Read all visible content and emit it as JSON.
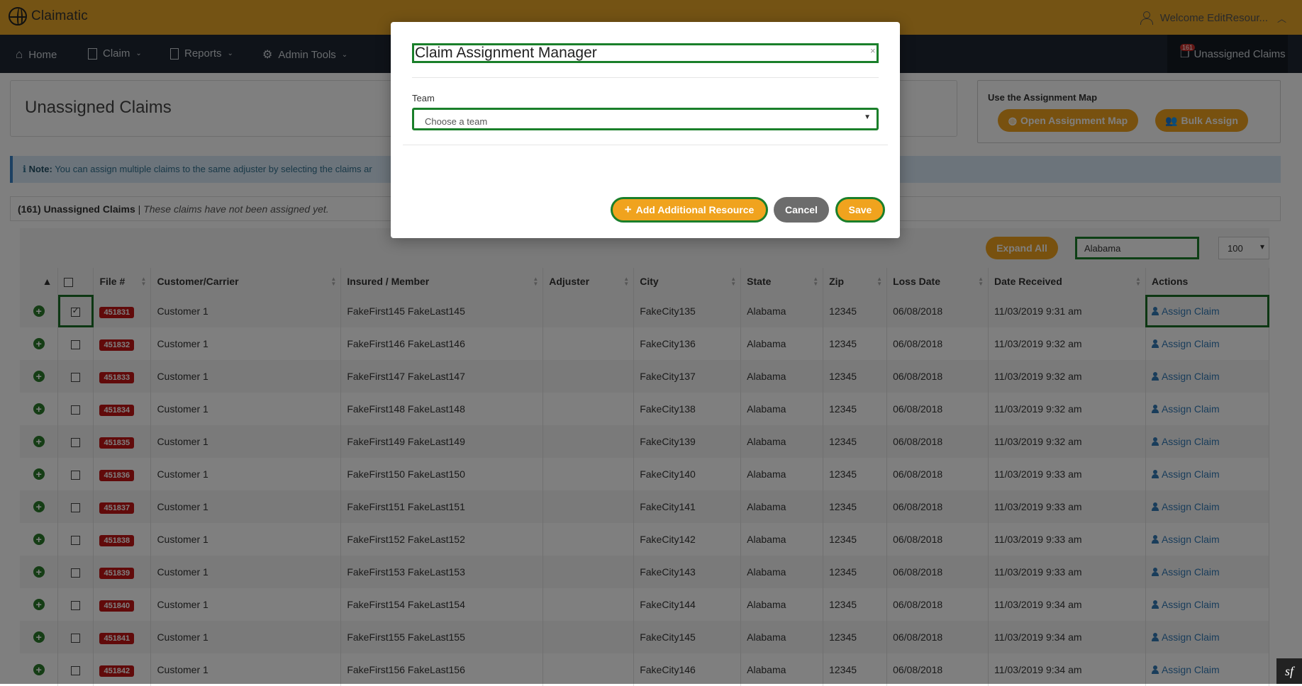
{
  "app": {
    "name": "Claimatic",
    "welcome": "Welcome EditResour..."
  },
  "nav": {
    "home": "Home",
    "claim": "Claim",
    "reports": "Reports",
    "admin_tools": "Admin Tools",
    "unassigned_claims": "Unassigned Claims",
    "unassigned_count": "161"
  },
  "page": {
    "title": "Unassigned Claims",
    "assign_map_title": "Use the Assignment Map",
    "open_map_label": "Open Assignment Map",
    "bulk_assign_label": "Bulk Assign",
    "note_label": "Note:",
    "note_text": "You can assign multiple claims to the same adjuster by selecting the claims ar",
    "list_count": "(161) Unassigned Claims",
    "list_sub": "These claims have not been assigned yet."
  },
  "tools": {
    "expand_all": "Expand All",
    "search_value": "Alabama",
    "page_size": "100"
  },
  "table": {
    "headers": [
      "File #",
      "Customer/Carrier",
      "Insured / Member",
      "Adjuster",
      "City",
      "State",
      "Zip",
      "Loss Date",
      "Date Received",
      "Actions"
    ],
    "action_label": "Assign Claim",
    "rows": [
      {
        "file": "451831",
        "customer": "Customer 1",
        "insured": "FakeFirst145 FakeLast145",
        "adjuster": "",
        "city": "FakeCity135",
        "state": "Alabama",
        "zip": "12345",
        "loss": "06/08/2018",
        "received": "11/03/2019 9:31 am",
        "checked": true
      },
      {
        "file": "451832",
        "customer": "Customer 1",
        "insured": "FakeFirst146 FakeLast146",
        "adjuster": "",
        "city": "FakeCity136",
        "state": "Alabama",
        "zip": "12345",
        "loss": "06/08/2018",
        "received": "11/03/2019 9:32 am",
        "checked": false
      },
      {
        "file": "451833",
        "customer": "Customer 1",
        "insured": "FakeFirst147 FakeLast147",
        "adjuster": "",
        "city": "FakeCity137",
        "state": "Alabama",
        "zip": "12345",
        "loss": "06/08/2018",
        "received": "11/03/2019 9:32 am",
        "checked": false
      },
      {
        "file": "451834",
        "customer": "Customer 1",
        "insured": "FakeFirst148 FakeLast148",
        "adjuster": "",
        "city": "FakeCity138",
        "state": "Alabama",
        "zip": "12345",
        "loss": "06/08/2018",
        "received": "11/03/2019 9:32 am",
        "checked": false
      },
      {
        "file": "451835",
        "customer": "Customer 1",
        "insured": "FakeFirst149 FakeLast149",
        "adjuster": "",
        "city": "FakeCity139",
        "state": "Alabama",
        "zip": "12345",
        "loss": "06/08/2018",
        "received": "11/03/2019 9:32 am",
        "checked": false
      },
      {
        "file": "451836",
        "customer": "Customer 1",
        "insured": "FakeFirst150 FakeLast150",
        "adjuster": "",
        "city": "FakeCity140",
        "state": "Alabama",
        "zip": "12345",
        "loss": "06/08/2018",
        "received": "11/03/2019 9:33 am",
        "checked": false
      },
      {
        "file": "451837",
        "customer": "Customer 1",
        "insured": "FakeFirst151 FakeLast151",
        "adjuster": "",
        "city": "FakeCity141",
        "state": "Alabama",
        "zip": "12345",
        "loss": "06/08/2018",
        "received": "11/03/2019 9:33 am",
        "checked": false
      },
      {
        "file": "451838",
        "customer": "Customer 1",
        "insured": "FakeFirst152 FakeLast152",
        "adjuster": "",
        "city": "FakeCity142",
        "state": "Alabama",
        "zip": "12345",
        "loss": "06/08/2018",
        "received": "11/03/2019 9:33 am",
        "checked": false
      },
      {
        "file": "451839",
        "customer": "Customer 1",
        "insured": "FakeFirst153 FakeLast153",
        "adjuster": "",
        "city": "FakeCity143",
        "state": "Alabama",
        "zip": "12345",
        "loss": "06/08/2018",
        "received": "11/03/2019 9:33 am",
        "checked": false
      },
      {
        "file": "451840",
        "customer": "Customer 1",
        "insured": "FakeFirst154 FakeLast154",
        "adjuster": "",
        "city": "FakeCity144",
        "state": "Alabama",
        "zip": "12345",
        "loss": "06/08/2018",
        "received": "11/03/2019 9:34 am",
        "checked": false
      },
      {
        "file": "451841",
        "customer": "Customer 1",
        "insured": "FakeFirst155 FakeLast155",
        "adjuster": "",
        "city": "FakeCity145",
        "state": "Alabama",
        "zip": "12345",
        "loss": "06/08/2018",
        "received": "11/03/2019 9:34 am",
        "checked": false
      },
      {
        "file": "451842",
        "customer": "Customer 1",
        "insured": "FakeFirst156 FakeLast156",
        "adjuster": "",
        "city": "FakeCity146",
        "state": "Alabama",
        "zip": "12345",
        "loss": "06/08/2018",
        "received": "11/03/2019 9:34 am",
        "checked": false
      }
    ]
  },
  "modal": {
    "title": "Claim Assignment Manager",
    "close": "×",
    "team_label": "Team",
    "team_placeholder": "Choose a team",
    "add_resource": "Add Additional Resource",
    "cancel": "Cancel",
    "save": "Save"
  },
  "colors": {
    "brand_orange": "#e8a628",
    "nav_dark": "#1f2733",
    "button_orange": "#f0a31e",
    "focus_green": "#1a7f2a",
    "badge_red": "#c21414",
    "link_blue": "#337ab7"
  }
}
